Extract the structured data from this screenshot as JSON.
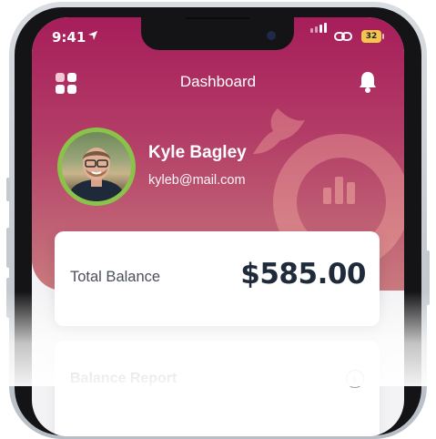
{
  "status_bar": {
    "time": "9:41",
    "battery": "32"
  },
  "header": {
    "title": "Dashboard"
  },
  "profile": {
    "name": "Kyle Bagley",
    "email": "kyleb@mail.com"
  },
  "balance_card": {
    "label": "Total Balance",
    "amount": "$585.00"
  },
  "report_card": {
    "title": "Balance Report",
    "info_icon_glyph": "i"
  },
  "colors": {
    "header_gradient_top": "#a71d5a",
    "header_gradient_bottom": "#c97a7e",
    "avatar_ring": "#8bc34a",
    "battery": "#f4c64e",
    "amount_text": "#1f2b3a"
  },
  "icons": [
    "location-arrow-icon",
    "signal-icon",
    "link-icon",
    "battery-icon",
    "menu-grid-icon",
    "bell-icon",
    "info-icon"
  ]
}
